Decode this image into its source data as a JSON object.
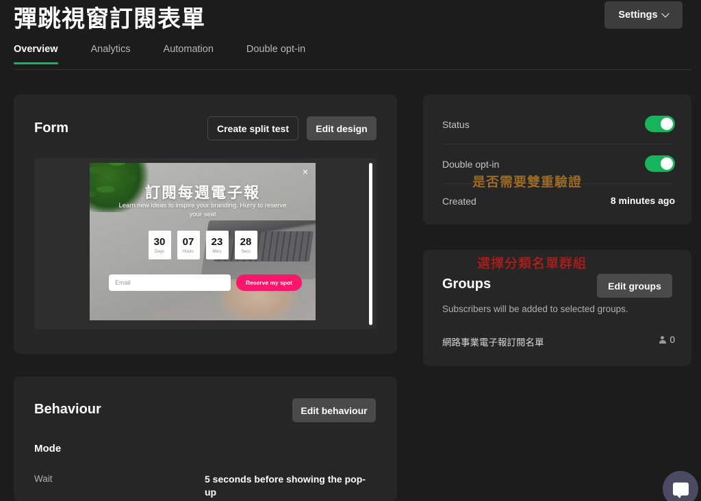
{
  "header": {
    "title": "彈跳視窗訂閱表單",
    "settings_label": "Settings",
    "chevron_icon": "chevron-down-icon",
    "tabs": [
      {
        "label": "Overview",
        "active": true
      },
      {
        "label": "Analytics",
        "active": false
      },
      {
        "label": "Automation",
        "active": false
      },
      {
        "label": "Double opt-in",
        "active": false
      }
    ]
  },
  "form_card": {
    "title": "Form",
    "create_split_test_label": "Create split test",
    "edit_design_label": "Edit design",
    "preview": {
      "close_icon": "close-icon",
      "heading": "訂閱每週電子報",
      "subheading": "Learn new ideas to inspire your branding. Hurry to reserve your seat",
      "countdown": [
        {
          "value": "30",
          "label": "Days"
        },
        {
          "value": "07",
          "label": "Hours"
        },
        {
          "value": "23",
          "label": "Mins"
        },
        {
          "value": "28",
          "label": "Secs"
        }
      ],
      "email_placeholder": "Email",
      "cta_label": "Reserve my spot",
      "cta_color": "#f8156a"
    }
  },
  "behaviour_card": {
    "title": "Behaviour",
    "edit_label": "Edit behaviour",
    "mode_label": "Mode",
    "rows": [
      {
        "label": "Wait",
        "value": "5 seconds before showing the pop-up"
      }
    ]
  },
  "status_card": {
    "rows": [
      {
        "label": "Status",
        "type": "toggle",
        "value": "on"
      },
      {
        "label": "Double opt-in",
        "type": "toggle",
        "value": "on"
      },
      {
        "label": "Created",
        "type": "text",
        "value": "8 minutes ago"
      }
    ],
    "toggle_color": "#17b45c"
  },
  "groups_card": {
    "title": "Groups",
    "edit_label": "Edit groups",
    "description": "Subscribers will be added to selected groups.",
    "groups": [
      {
        "name": "網路事業電子報訂閱名單",
        "count": "0",
        "icon": "person-icon"
      }
    ]
  },
  "annotations": [
    {
      "text": "是否需要雙重驗證",
      "color": "#eca43a"
    },
    {
      "text": "選擇分類名單群組",
      "color": "#f0332f"
    }
  ],
  "chat_widget": {
    "icon": "chat-bubble-icon"
  }
}
